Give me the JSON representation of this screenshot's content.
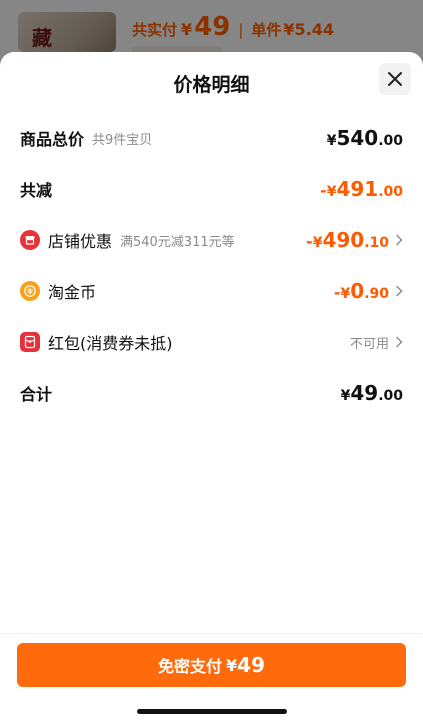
{
  "background": {
    "total_label": "共实付",
    "currency": "¥",
    "total_value": "49",
    "separator": "|",
    "unit_label": "单件",
    "unit_value": "¥5.44"
  },
  "sheet": {
    "title": "价格明细",
    "close_icon": "close-icon"
  },
  "rows": {
    "goods_total": {
      "label": "商品总价",
      "sub": "共9件宝贝",
      "yen": "¥",
      "int": "540",
      "dec": ".00"
    },
    "total_reduce": {
      "label": "共减",
      "sign": "-",
      "yen": "¥",
      "int": "491",
      "dec": ".00"
    },
    "store_discount": {
      "label": "店铺优惠",
      "sub": "满540元减311元等",
      "sign": "-",
      "yen": "¥",
      "int": "490",
      "dec": ".10",
      "icon": "store-coupon-icon"
    },
    "taojinbi": {
      "label": "淘金币",
      "sign": "-",
      "yen": "¥",
      "int": "0",
      "dec": ".90",
      "icon": "coin-icon"
    },
    "red_packet": {
      "label": "红包(消费券未抵)",
      "status": "不可用",
      "icon": "red-packet-icon"
    },
    "grand_total": {
      "label": "合计",
      "yen": "¥",
      "int": "49",
      "dec": ".00"
    }
  },
  "footer": {
    "pay_label": "免密支付",
    "yen": "¥",
    "value": "49"
  },
  "colors": {
    "accent": "#ff5a00",
    "button": "#ff6a0d",
    "store_icon": "#e8313a",
    "coin_icon": "#f7a21b",
    "red_packet_icon": "#e8313a"
  }
}
